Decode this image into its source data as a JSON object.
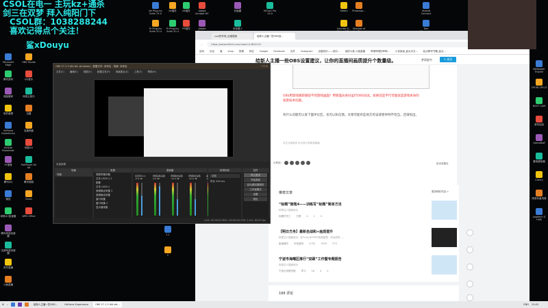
{
  "overlay": {
    "line1": "CSOL在电一 主玩kz+通杀",
    "line2": "剑三在双梦 拜入纯阳门下",
    "line3": "CSOL群：1038288244",
    "line4": "喜欢记得点个关注！",
    "douyu": "鲨xDouyu"
  },
  "desktop_top": [
    {
      "label": "Ae Plug-ins Suite 15.0"
    },
    {
      "label": "AE插件"
    },
    {
      "label": "AE插件"
    },
    {
      "label": "Adobe Acrobat DC"
    },
    {
      "label": "封面图"
    },
    {
      "label": "VEGAS Pro 15.0"
    },
    {
      "label": "Steam"
    },
    {
      "label": "Phasmop..."
    },
    {
      "label": "Ubisoft Connect"
    },
    {
      "label": "Pr Plug-ins Suite 20.4"
    },
    {
      "label": "Pr Plug-ins Suite 20.4"
    },
    {
      "label": "PR插件"
    },
    {
      "label": "Adobe Prelu..."
    },
    {
      "label": "未标题-1"
    },
    {
      "label": "Counter-S... Global Off..."
    },
    {
      "label": "Shadow of the Tom..."
    },
    {
      "label": "Tom Clancy's..."
    }
  ],
  "desktop_left": [
    {
      "label": "Microsoft Edge"
    },
    {
      "label": "OBS Studio"
    },
    {
      "label": "腾讯游戏"
    },
    {
      "label": "QQ音乐"
    },
    {
      "label": "电脑管家"
    },
    {
      "label": "网易云音乐"
    },
    {
      "label": "软件管理"
    },
    {
      "label": "迅雷"
    },
    {
      "label": "GeForce Experience"
    },
    {
      "label": "百度网盘"
    },
    {
      "label": "NVIDIA Broadcast"
    },
    {
      "label": "网易UU"
    },
    {
      "label": "YY语音"
    },
    {
      "label": "PotPlayer 64 bit"
    },
    {
      "label": "腾讯QQ"
    },
    {
      "label": "腾讯视频"
    },
    {
      "label": "微信"
    },
    {
      "label": "Excel"
    },
    {
      "label": "网易UU加速器"
    },
    {
      "label": "WPS Office"
    },
    {
      "label": "腾讯网游加速器"
    },
    {
      "label": "迅游网游加速器"
    },
    {
      "label": "虎牙直播"
    },
    {
      "label": "斗鱼直播"
    }
  ],
  "desktop_right": [
    {
      "label": "Wallpaper Engine"
    },
    {
      "label": "CPUID CPU-Z"
    },
    {
      "label": "NZXT CAM"
    },
    {
      "label": "游戏加加"
    },
    {
      "label": "GameBuff"
    },
    {
      "label": "雷电模拟器"
    },
    {
      "label": "Cherry"
    },
    {
      "label": "网易有道词典"
    },
    {
      "label": "Logitech G HUB"
    }
  ],
  "desktop_folders": [
    {
      "label": "1.1"
    },
    {
      "label": "2"
    }
  ],
  "obs": {
    "title": "OBS 27.1.3 (64-bit, windows) - 配置文件: 未命名 - 场景: 未命名",
    "menu": [
      "文件(F)",
      "编辑(E)",
      "视图(V)",
      "配置文件(P)",
      "场景集合(S)",
      "工具(T)",
      "帮助(H)"
    ],
    "scene_label": "未选择源",
    "scenes_header": "场景",
    "scenes": [
      "场景"
    ],
    "sources_header": "来源",
    "sources": [
      "视频采集设备",
      "文本 (GDI+) 2",
      "图像",
      "文本 (GDI+)",
      "音频输出采集 2",
      "音频输出采集",
      "窗口采集",
      "窗口采集 2",
      "显示器采集"
    ],
    "mixer_header": "混音器",
    "mixer": [
      {
        "name": "麦克风/Aux",
        "db": "-0.0 dB",
        "level": 0.6
      },
      {
        "name": "视频采集设备",
        "db": "0.0 dB",
        "level": 0.9
      },
      {
        "name": "音频输出采集",
        "db": "-12.0 dB",
        "level": 0.5
      },
      {
        "name": "音频输出采集 2",
        "db": "-12.0 dB",
        "level": 0.5
      },
      {
        "name": "桌面音频",
        "db": "-12.0 dB",
        "level": 0.5
      }
    ],
    "transitions_header": "转场特效",
    "transition": "淡化",
    "duration_label": "时长",
    "duration": "300 ms",
    "controls_header": "控件",
    "controls": [
      "停止推流",
      "开始录制",
      "启动虚拟摄像机",
      "工作室模式",
      "设置",
      "退出"
    ],
    "status": "LIVE: 00:00:00  REC: 00:00:00  CPU: 1.0%, 60.00 fps"
  },
  "browser": {
    "tabs": [
      "csol的专场_百度搜索",
      "给新人主播一些OBS设..."
    ],
    "url": "https://www.bilibili.com/read/cv14824122",
    "bookmarks": [
      "百科",
      "论坛",
      "道",
      "shop",
      "剪辑",
      "师生",
      "Google",
      "Facebook",
      "文件",
      "Instagram",
      "百度知识——设问...",
      "我的斗鱼 斗鱼直播",
      "哔哩哔哩的声明..."
    ],
    "bookmarks_right": [
      "小说阅读_起点中文...",
      "起点教学书籍_起点..."
    ],
    "article_title": "给新人主播一些OBS设置建议，让你的直播间画质提升个数量级。",
    "author": "梦鸦星中",
    "follow": "+ 关注",
    "red_text": "OBS用游戏捕获捕捉不到游戏画面？用管理员身份运行OBS试试。如果还是不行可能就是游戏本身的加密技术问题。",
    "body_text": "有什么问题可以发下面评论区，也可以私信我。文章可能有些地方有误或者举例不恰当，还请指出。",
    "copyright": "本文为我原创  本文禁止转载或摘编",
    "share_label": "分享到：",
    "report": "投诉或建议",
    "recommend_header": "推荐文章",
    "more": "更多精彩内容 >",
    "recs": [
      {
        "title": "“标题”随笔4——训练写“标题”简单方法",
        "sub": "标签达人搜索设示",
        "author": "标题在写工",
        "tag": "日常",
        "views": "4",
        "likes": "1",
        "comments": "0"
      },
      {
        "title": "【明日方舟】最新自战和+画质提升",
        "sub": "标签达人搜索设示：在Fruity中TRPG的测量里，作战讲究……",
        "author": "影画娱乐",
        "tag": "手机游戏",
        "views": "4.3万",
        "likes": "1259",
        "comments": "273"
      },
      {
        "title": "宁波市海曙区推行“双碳”工作暨专题报告",
        "sub": "标签达人搜索设示",
        "author": "宁波大学图书馆",
        "tag": "学习",
        "views": "18",
        "likes": "4",
        "comments": "0"
      }
    ],
    "comments": "188  评论"
  },
  "taskbar": {
    "items": [
      "给新人主播一些OBS...",
      "GeForce Experience",
      "OBS 27.1.3 (64-bit..."
    ],
    "time": "13:45",
    "lang": "ENG"
  }
}
